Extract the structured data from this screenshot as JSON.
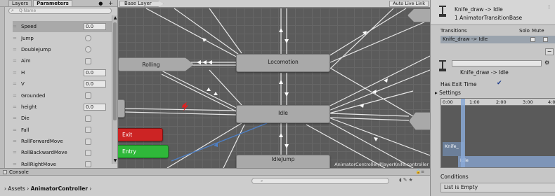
{
  "left_panel": {
    "tabs": [
      "Layers",
      "Parameters"
    ],
    "search_placeholder": "Q·Name",
    "parameters": [
      {
        "name": "Speed",
        "type": "float",
        "value": "0.0",
        "selected": true
      },
      {
        "name": "Jump",
        "type": "trigger"
      },
      {
        "name": "DoubleJump",
        "type": "trigger"
      },
      {
        "name": "Aim",
        "type": "bool"
      },
      {
        "name": "H",
        "type": "float",
        "value": "0.0"
      },
      {
        "name": "V",
        "type": "float",
        "value": "0.0"
      },
      {
        "name": "Grounded",
        "type": "bool"
      },
      {
        "name": "height",
        "type": "float",
        "value": "0.0"
      },
      {
        "name": "Die",
        "type": "bool"
      },
      {
        "name": "Fall",
        "type": "bool"
      },
      {
        "name": "RollForwardMove",
        "type": "bool"
      },
      {
        "name": "RollBackwardMove",
        "type": "bool"
      },
      {
        "name": "RollRightMove",
        "type": "bool"
      }
    ]
  },
  "graph": {
    "layer_breadcrumb": "Base Layer",
    "auto_live_link": "Auto Live Link",
    "nodes": {
      "rolling": "Rolling",
      "locomotion": "Locomotion",
      "idle": "Idle",
      "idle_jump": "IdleJump",
      "exit": "Exit",
      "entry": "Entry"
    },
    "controller_path": "AnimatorController/PlayerKnife.controller"
  },
  "inspector": {
    "title": "Knife_draw -> Idle",
    "subtitle": "1 AnimatorTransitionBase",
    "transitions_header": "Transitions",
    "solo_label": "Solo",
    "mute_label": "Mute",
    "transition_row": "Knife_draw -> Idle",
    "transition_name": "Knife_draw -> Idle",
    "has_exit_time_label": "Has Exit Time",
    "settings_label": "Settings",
    "timeline_ticks": [
      "0:00",
      "1:00",
      "2:00",
      "3:00",
      "4:00"
    ],
    "timeline_clips": {
      "knife": "Knife_",
      "idle": "Idle"
    },
    "conditions_label": "Conditions",
    "conditions_value": "List is Empty"
  },
  "bottom": {
    "console_label": "Console",
    "breadcrumb_root": "Assets",
    "breadcrumb_folder": "AnimatorController",
    "separator": "›"
  }
}
